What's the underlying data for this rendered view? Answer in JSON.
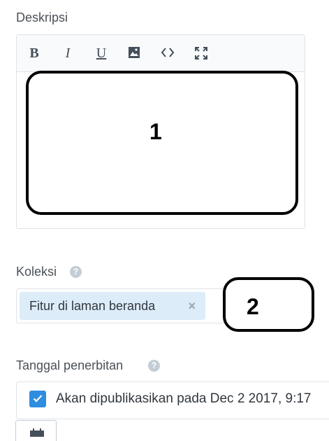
{
  "description": {
    "label": "Deskripsi",
    "toolbar": {
      "bold": "B",
      "italic": "I",
      "underline": "U",
      "image_icon": "image-icon",
      "code_icon": "code-icon",
      "fullscreen_icon": "fullscreen-icon"
    },
    "annotation_number": "1"
  },
  "collection": {
    "label": "Koleksi",
    "help_icon": "question-circle-icon",
    "tags": [
      "Fitur di laman beranda"
    ],
    "tag_remove": "×",
    "annotation_number": "2"
  },
  "publish_date": {
    "label": "Tanggal penerbitan",
    "help_icon": "question-circle-icon",
    "checkbox_checked": true,
    "text": "Akan dipublikasikan pada Dec 2 2017, 9:17",
    "calendar_icon": "calendar-icon"
  },
  "colors": {
    "accent": "#2e8ddf",
    "tag_background": "#dcecf8",
    "border": "#dfe3e8"
  }
}
